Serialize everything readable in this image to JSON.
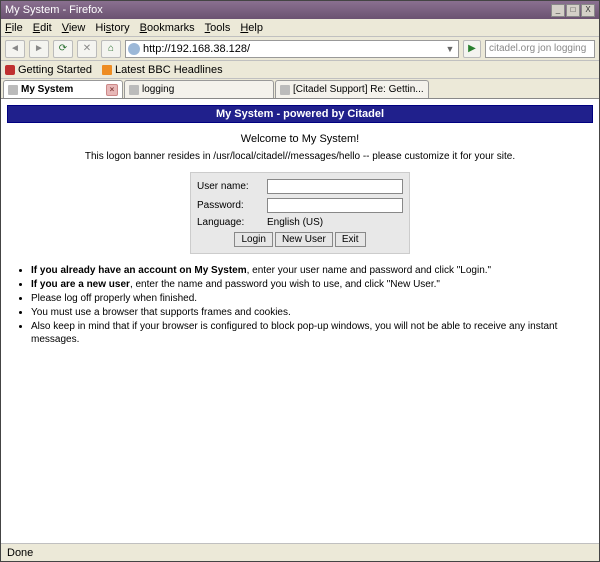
{
  "window": {
    "title": "My System - Firefox"
  },
  "winbtn": {
    "min": "_",
    "max": "□",
    "close": "X"
  },
  "menu": {
    "file": "File",
    "edit": "Edit",
    "view": "View",
    "history": "History",
    "bookmarks": "Bookmarks",
    "tools": "Tools",
    "help": "Help"
  },
  "url": {
    "value": "http://192.168.38.128/"
  },
  "search": {
    "placeholder": "citadel.org jon logging"
  },
  "bookmarks": {
    "b1": "Getting Started",
    "b2": "Latest BBC Headlines"
  },
  "tabs": {
    "t1": "My System",
    "t2": "logging",
    "t3": "[Citadel Support] Re: Gettin..."
  },
  "page": {
    "banner": "My System - powered by Citadel",
    "welcome": "Welcome to My System!",
    "sub": "This logon banner resides in /usr/local/citadel//messages/hello -- please customize it for your site.",
    "login": {
      "username_label": "User name:",
      "password_label": "Password:",
      "language_label": "Language:",
      "language_value": "English (US)",
      "btn_login": "Login",
      "btn_new": "New User",
      "btn_exit": "Exit"
    },
    "bullets": {
      "b1a": "If you already have an account on My System",
      "b1b": ", enter your user name and password and click \"Login.\"",
      "b2a": "If you are a new user",
      "b2b": ", enter the name and password you wish to use, and click \"New User.\"",
      "b3": "Please log off properly when finished.",
      "b4": "You must use a browser that supports frames and cookies.",
      "b5": "Also keep in mind that if your browser is configured to block pop-up windows, you will not be able to receive any instant messages."
    }
  },
  "status": {
    "text": "Done"
  }
}
